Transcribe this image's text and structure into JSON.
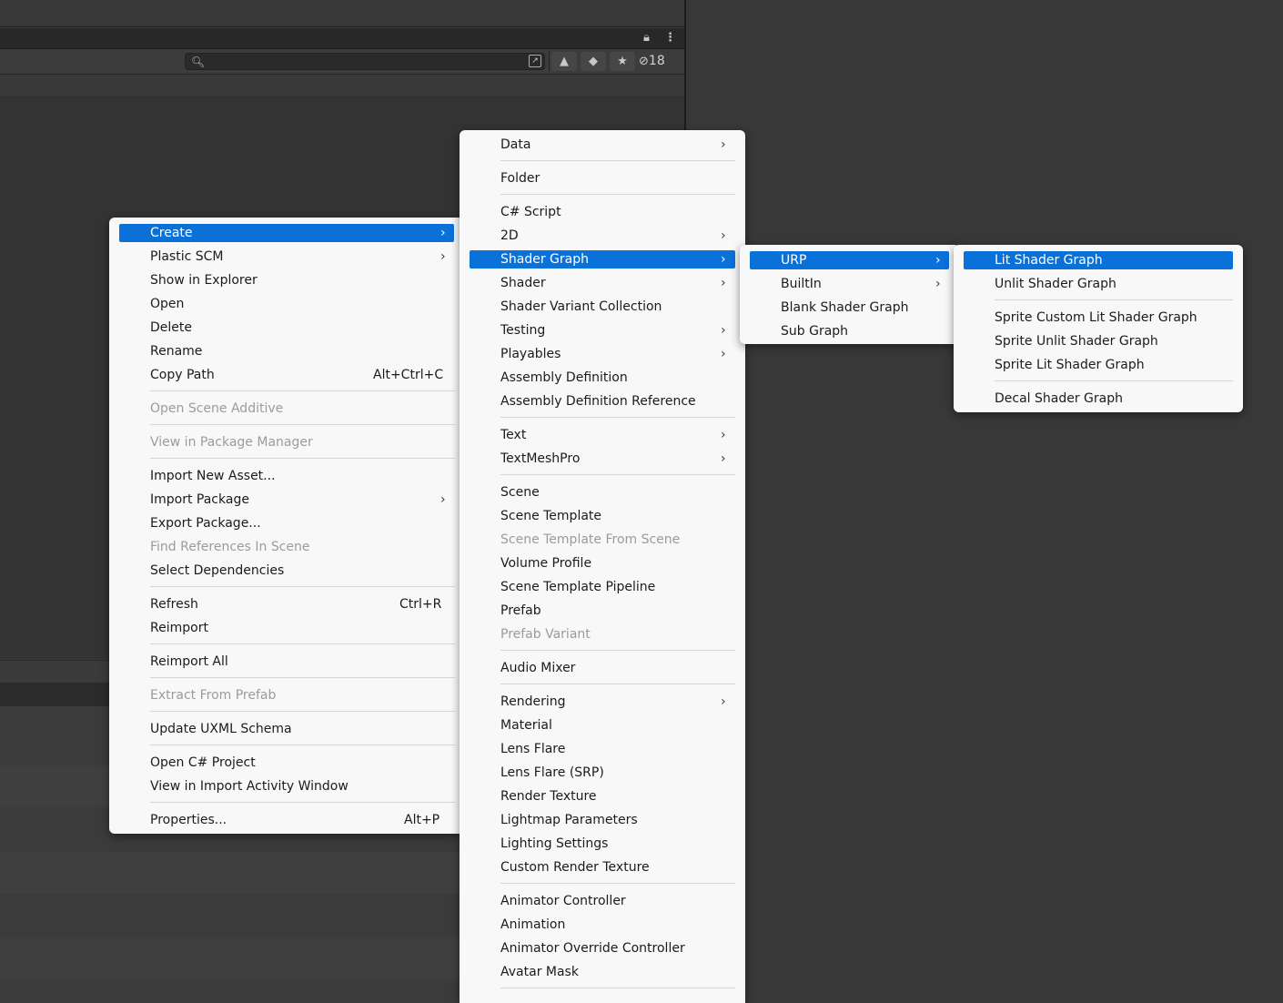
{
  "toolbar": {
    "search_placeholder": "",
    "icons": [
      "lock-icon",
      "kebab-menu-icon",
      "search-icon",
      "search-mode-icon",
      "filter-by-type-icon",
      "filter-by-label-icon",
      "favorites-star-icon",
      "hidden-packages-icon"
    ],
    "hidden_count": "18"
  },
  "colors": {
    "selection_blue": "#0a71d9",
    "menu_background": "#f8f8f8",
    "disabled_text": "#9b9b9b",
    "editor_background": "#383838"
  },
  "main_menu": {
    "items": [
      {
        "label": "Create",
        "submenu": true,
        "selected": true
      },
      {
        "label": "Plastic SCM",
        "submenu": true
      },
      {
        "label": "Show in Explorer"
      },
      {
        "label": "Open"
      },
      {
        "label": "Delete"
      },
      {
        "label": "Rename"
      },
      {
        "label": "Copy Path",
        "shortcut": "Alt+Ctrl+C"
      },
      {
        "label": "Open Scene Additive",
        "disabled": true
      },
      {
        "label": "View in Package Manager",
        "disabled": true
      },
      {
        "label": "Import New Asset..."
      },
      {
        "label": "Import Package",
        "submenu": true
      },
      {
        "label": "Export Package..."
      },
      {
        "label": "Find References In Scene",
        "disabled": true
      },
      {
        "label": "Select Dependencies"
      },
      {
        "label": "Refresh",
        "shortcut": "Ctrl+R"
      },
      {
        "label": "Reimport"
      },
      {
        "label": "Reimport All"
      },
      {
        "label": "Extract From Prefab",
        "disabled": true
      },
      {
        "label": "Update UXML Schema"
      },
      {
        "label": "Open C# Project"
      },
      {
        "label": "View in Import Activity Window"
      },
      {
        "label": "Properties...",
        "shortcut": "Alt+P"
      }
    ]
  },
  "create_menu": {
    "items": [
      {
        "label": "Data",
        "submenu": true
      },
      {
        "label": "Folder"
      },
      {
        "label": "C# Script"
      },
      {
        "label": "2D",
        "submenu": true
      },
      {
        "label": "Shader Graph",
        "submenu": true,
        "selected": true
      },
      {
        "label": "Shader",
        "submenu": true
      },
      {
        "label": "Shader Variant Collection"
      },
      {
        "label": "Testing",
        "submenu": true
      },
      {
        "label": "Playables",
        "submenu": true
      },
      {
        "label": "Assembly Definition"
      },
      {
        "label": "Assembly Definition Reference"
      },
      {
        "label": "Text",
        "submenu": true
      },
      {
        "label": "TextMeshPro",
        "submenu": true
      },
      {
        "label": "Scene"
      },
      {
        "label": "Scene Template"
      },
      {
        "label": "Scene Template From Scene",
        "disabled": true
      },
      {
        "label": "Volume Profile"
      },
      {
        "label": "Scene Template Pipeline"
      },
      {
        "label": "Prefab"
      },
      {
        "label": "Prefab Variant",
        "disabled": true
      },
      {
        "label": "Audio Mixer"
      },
      {
        "label": "Rendering",
        "submenu": true
      },
      {
        "label": "Material"
      },
      {
        "label": "Lens Flare"
      },
      {
        "label": "Lens Flare (SRP)"
      },
      {
        "label": "Render Texture"
      },
      {
        "label": "Lightmap Parameters"
      },
      {
        "label": "Lighting Settings"
      },
      {
        "label": "Custom Render Texture"
      },
      {
        "label": "Animator Controller"
      },
      {
        "label": "Animation"
      },
      {
        "label": "Animator Override Controller"
      },
      {
        "label": "Avatar Mask"
      }
    ]
  },
  "shader_graph_menu": {
    "items": [
      {
        "label": "URP",
        "submenu": true,
        "selected": true
      },
      {
        "label": "BuiltIn",
        "submenu": true
      },
      {
        "label": "Blank Shader Graph"
      },
      {
        "label": "Sub Graph"
      }
    ]
  },
  "urp_menu": {
    "items": [
      {
        "label": "Lit Shader Graph",
        "selected": true
      },
      {
        "label": "Unlit Shader Graph"
      },
      {
        "label": "Sprite Custom Lit Shader Graph"
      },
      {
        "label": "Sprite Unlit Shader Graph"
      },
      {
        "label": "Sprite Lit Shader Graph"
      },
      {
        "label": "Decal Shader Graph"
      }
    ]
  }
}
